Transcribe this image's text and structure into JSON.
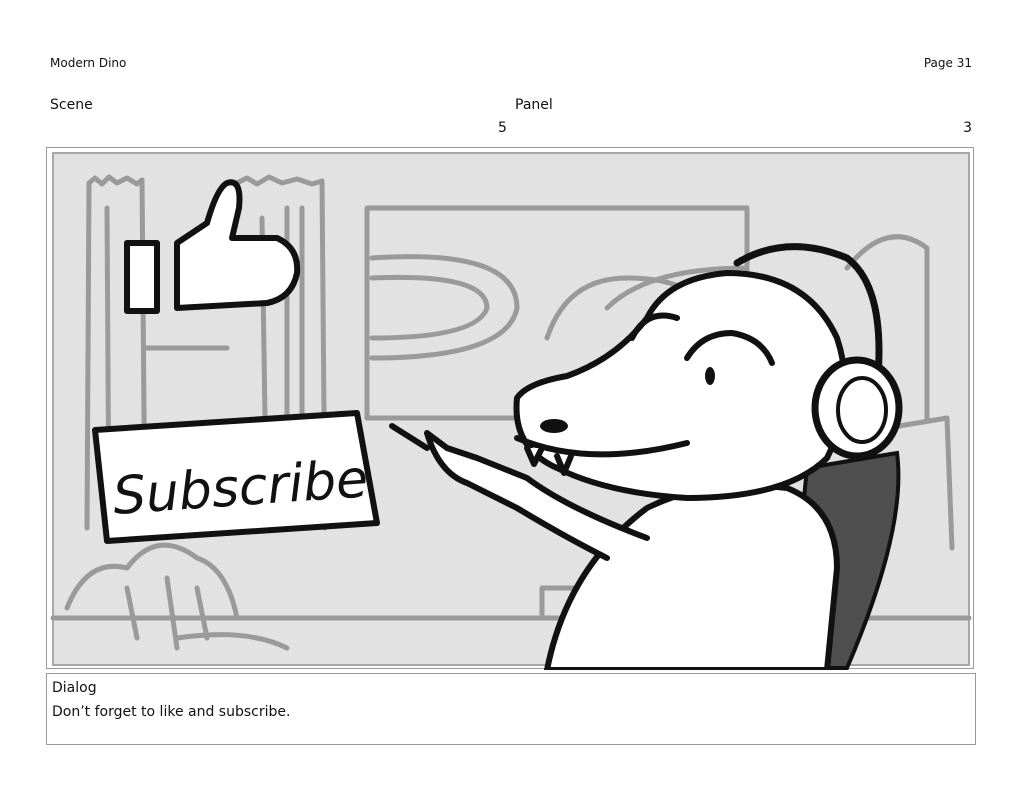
{
  "header": {
    "project_title": "Modern Dino",
    "page_number": "Page 31",
    "scene_label": "Scene",
    "panel_label": "Panel",
    "scene_value": "5",
    "panel_value": "3"
  },
  "panel_art": {
    "sign_text": "Subscribe",
    "icons": [
      "thumbs-up-icon",
      "headphones-icon"
    ]
  },
  "dialog": {
    "label": "Dialog",
    "text": "Don’t forget to like and subscribe."
  }
}
